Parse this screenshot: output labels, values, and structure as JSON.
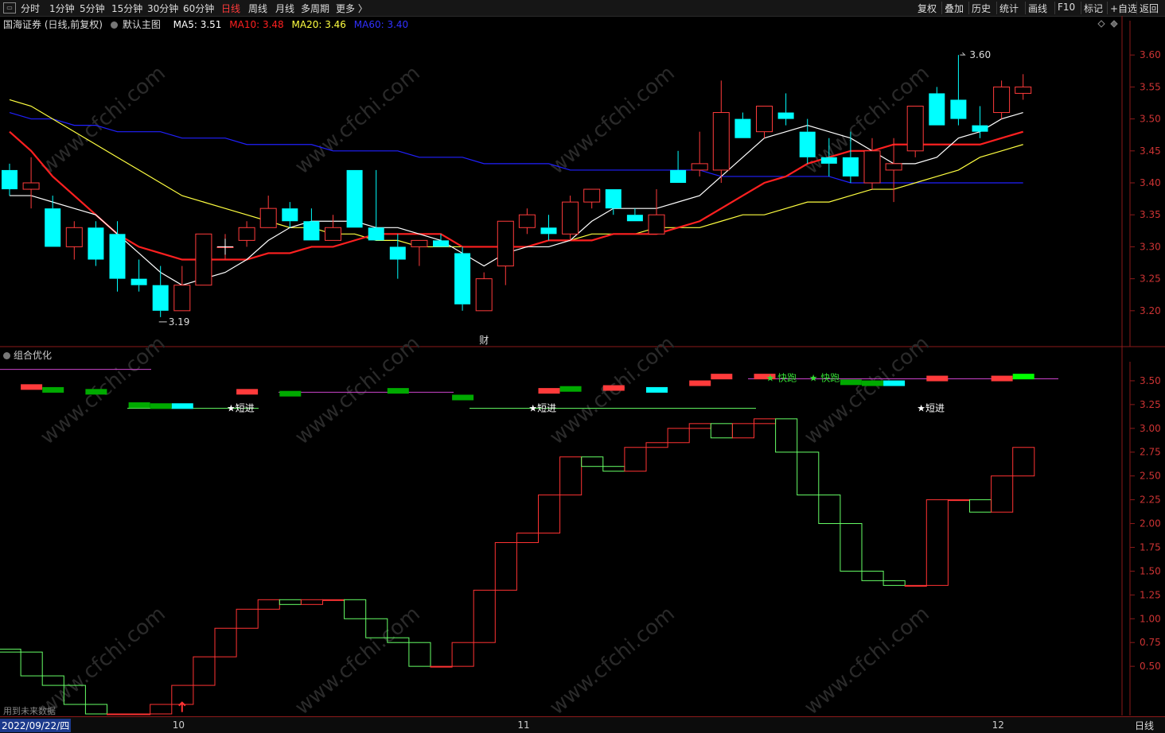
{
  "toolbar": {
    "left": [
      "分时",
      "1分钟",
      "5分钟",
      "15分钟",
      "30分钟",
      "60分钟",
      "日线",
      "周线",
      "月线",
      "多周期",
      "更多 〉"
    ],
    "active_index": 6,
    "right": [
      "复权",
      "叠加",
      "历史",
      "统计",
      "画线",
      "F10",
      "标记",
      "+自选",
      "返回"
    ]
  },
  "main": {
    "stock": "国海证券 (日线,前复权)",
    "template": "默认主图",
    "ma5": "MA5: 3.51",
    "ma10": "MA10: 3.48",
    "ma20": "MA20: 3.46",
    "ma60": "MA60: 3.40",
    "high_label": "3.60",
    "low_label": "3.19",
    "cai_label": "财"
  },
  "sub": {
    "name": "组合优化",
    "signals": [
      {
        "text": "★短进",
        "bar": 10
      },
      {
        "text": "★短进",
        "bar": 24
      },
      {
        "text": "★ 快跑",
        "bar": 35
      },
      {
        "text": "★ 快跑",
        "bar": 37
      },
      {
        "text": "★短进",
        "bar": 42
      }
    ]
  },
  "footer": "用到未来数据",
  "bottom": {
    "date": "2022/09/22/四",
    "months": [
      {
        "label": "10",
        "bar": 8
      },
      {
        "label": "11",
        "bar": 24
      },
      {
        "label": "12",
        "bar": 46
      }
    ],
    "period": "日线"
  },
  "colors": {
    "up": "#ff3b3b",
    "down": "#00ffff",
    "ma5": "#ffffff",
    "ma10": "#ff2020",
    "ma20": "#ffff40",
    "ma60": "#2020ff",
    "step_up": "#ff3333",
    "step_down": "#66ff66"
  },
  "chart_data": {
    "type": "candlestick",
    "price_axis": {
      "ylim": [
        3.16,
        3.64
      ],
      "ticks": [
        3.2,
        3.25,
        3.3,
        3.35,
        3.4,
        3.45,
        3.5,
        3.55,
        3.6
      ]
    },
    "ohlc": [
      [
        3.42,
        3.43,
        3.38,
        3.39
      ],
      [
        3.39,
        3.44,
        3.36,
        3.4
      ],
      [
        3.36,
        3.38,
        3.3,
        3.3
      ],
      [
        3.3,
        3.34,
        3.28,
        3.33
      ],
      [
        3.33,
        3.34,
        3.27,
        3.28
      ],
      [
        3.32,
        3.34,
        3.23,
        3.25
      ],
      [
        3.25,
        3.28,
        3.23,
        3.24
      ],
      [
        3.24,
        3.27,
        3.19,
        3.2
      ],
      [
        3.2,
        3.27,
        3.2,
        3.24
      ],
      [
        3.24,
        3.32,
        3.24,
        3.32
      ],
      [
        3.3,
        3.32,
        3.28,
        3.3
      ],
      [
        3.31,
        3.34,
        3.3,
        3.33
      ],
      [
        3.33,
        3.38,
        3.33,
        3.36
      ],
      [
        3.36,
        3.37,
        3.33,
        3.34
      ],
      [
        3.34,
        3.36,
        3.31,
        3.31
      ],
      [
        3.31,
        3.35,
        3.31,
        3.33
      ],
      [
        3.42,
        3.42,
        3.33,
        3.33
      ],
      [
        3.33,
        3.42,
        3.32,
        3.31
      ],
      [
        3.3,
        3.32,
        3.25,
        3.28
      ],
      [
        3.3,
        3.31,
        3.27,
        3.31
      ],
      [
        3.31,
        3.32,
        3.3,
        3.3
      ],
      [
        3.29,
        3.3,
        3.2,
        3.21
      ],
      [
        3.2,
        3.26,
        3.2,
        3.25
      ],
      [
        3.27,
        3.3,
        3.24,
        3.34
      ],
      [
        3.33,
        3.36,
        3.32,
        3.35
      ],
      [
        3.33,
        3.35,
        3.31,
        3.32
      ],
      [
        3.32,
        3.38,
        3.31,
        3.37
      ],
      [
        3.37,
        3.39,
        3.36,
        3.39
      ],
      [
        3.39,
        3.39,
        3.35,
        3.36
      ],
      [
        3.35,
        3.36,
        3.34,
        3.34
      ],
      [
        3.32,
        3.39,
        3.32,
        3.35
      ],
      [
        3.42,
        3.45,
        3.4,
        3.4
      ],
      [
        3.42,
        3.48,
        3.41,
        3.43
      ],
      [
        3.42,
        3.56,
        3.4,
        3.51
      ],
      [
        3.5,
        3.51,
        3.47,
        3.47
      ],
      [
        3.48,
        3.52,
        3.47,
        3.52
      ],
      [
        3.51,
        3.54,
        3.49,
        3.5
      ],
      [
        3.48,
        3.5,
        3.43,
        3.44
      ],
      [
        3.44,
        3.47,
        3.41,
        3.43
      ],
      [
        3.44,
        3.48,
        3.4,
        3.41
      ],
      [
        3.4,
        3.47,
        3.39,
        3.45
      ],
      [
        3.42,
        3.47,
        3.37,
        3.43
      ],
      [
        3.45,
        3.51,
        3.44,
        3.52
      ],
      [
        3.54,
        3.55,
        3.49,
        3.49
      ],
      [
        3.53,
        3.6,
        3.49,
        3.5
      ],
      [
        3.49,
        3.52,
        3.47,
        3.48
      ],
      [
        3.51,
        3.56,
        3.5,
        3.55
      ],
      [
        3.54,
        3.57,
        3.53,
        3.55
      ]
    ],
    "ma5": [
      3.38,
      3.38,
      3.37,
      3.36,
      3.35,
      3.32,
      3.29,
      3.26,
      3.24,
      3.25,
      3.26,
      3.28,
      3.31,
      3.33,
      3.34,
      3.34,
      3.34,
      3.33,
      3.33,
      3.32,
      3.31,
      3.29,
      3.27,
      3.29,
      3.3,
      3.3,
      3.31,
      3.34,
      3.36,
      3.36,
      3.36,
      3.37,
      3.38,
      3.41,
      3.44,
      3.47,
      3.48,
      3.49,
      3.48,
      3.47,
      3.45,
      3.43,
      3.43,
      3.44,
      3.47,
      3.48,
      3.5,
      3.51
    ],
    "ma10": [
      3.48,
      3.45,
      3.41,
      3.38,
      3.35,
      3.32,
      3.3,
      3.29,
      3.28,
      3.28,
      3.28,
      3.28,
      3.29,
      3.29,
      3.3,
      3.3,
      3.31,
      3.32,
      3.32,
      3.32,
      3.32,
      3.3,
      3.3,
      3.3,
      3.3,
      3.31,
      3.31,
      3.31,
      3.32,
      3.32,
      3.32,
      3.33,
      3.34,
      3.36,
      3.38,
      3.4,
      3.41,
      3.43,
      3.44,
      3.45,
      3.45,
      3.46,
      3.46,
      3.46,
      3.46,
      3.46,
      3.47,
      3.48
    ],
    "ma20": [
      3.53,
      3.52,
      3.5,
      3.48,
      3.46,
      3.44,
      3.42,
      3.4,
      3.38,
      3.37,
      3.36,
      3.35,
      3.34,
      3.33,
      3.33,
      3.32,
      3.32,
      3.31,
      3.31,
      3.3,
      3.3,
      3.3,
      3.3,
      3.3,
      3.3,
      3.31,
      3.31,
      3.32,
      3.32,
      3.32,
      3.33,
      3.33,
      3.33,
      3.34,
      3.35,
      3.35,
      3.36,
      3.37,
      3.37,
      3.38,
      3.39,
      3.39,
      3.4,
      3.41,
      3.42,
      3.44,
      3.45,
      3.46
    ],
    "ma60": [
      3.51,
      3.5,
      3.5,
      3.49,
      3.49,
      3.48,
      3.48,
      3.48,
      3.47,
      3.47,
      3.47,
      3.46,
      3.46,
      3.46,
      3.46,
      3.45,
      3.45,
      3.45,
      3.45,
      3.44,
      3.44,
      3.44,
      3.43,
      3.43,
      3.43,
      3.43,
      3.42,
      3.42,
      3.42,
      3.42,
      3.42,
      3.42,
      3.42,
      3.41,
      3.41,
      3.41,
      3.41,
      3.41,
      3.41,
      3.4,
      3.4,
      3.4,
      3.4,
      3.4,
      3.4,
      3.4,
      3.4,
      3.4
    ],
    "indicator_axis": {
      "ylim": [
        0.0,
        3.7
      ],
      "ticks": [
        0.5,
        0.75,
        1.0,
        1.25,
        1.5,
        1.75,
        2.0,
        2.25,
        2.5,
        2.75,
        3.0,
        3.25,
        3.5
      ]
    },
    "step_values": [
      0.68,
      0.65,
      0.4,
      0.3,
      0.1,
      0.0,
      0.0,
      0.0,
      0.1,
      0.3,
      0.6,
      0.9,
      1.1,
      1.2,
      1.15,
      1.2,
      1.2,
      1.0,
      0.8,
      0.75,
      0.5,
      0.5,
      0.75,
      1.3,
      1.8,
      1.9,
      2.3,
      2.7,
      2.6,
      2.55,
      2.8,
      2.85,
      3.0,
      3.05,
      2.9,
      3.05,
      3.1,
      2.75,
      2.3,
      2.0,
      1.5,
      1.4,
      1.35,
      1.35,
      2.25,
      2.25,
      2.12,
      2.5,
      2.8
    ],
    "signal_bars": [
      {
        "bar": 1,
        "v": 3.43,
        "c": "#ff3b3b"
      },
      {
        "bar": 2,
        "v": 3.4,
        "c": "#00aa00"
      },
      {
        "bar": 4,
        "v": 3.38,
        "c": "#00aa00"
      },
      {
        "bar": 6,
        "v": 3.24,
        "c": "#00aa00"
      },
      {
        "bar": 7,
        "v": 3.23,
        "c": "#00aa00"
      },
      {
        "bar": 8,
        "v": 3.23,
        "c": "#00ffff"
      },
      {
        "bar": 11,
        "v": 3.38,
        "c": "#ff3b3b"
      },
      {
        "bar": 13,
        "v": 3.36,
        "c": "#00aa00"
      },
      {
        "bar": 18,
        "v": 3.39,
        "c": "#00aa00"
      },
      {
        "bar": 21,
        "v": 3.32,
        "c": "#00aa00"
      },
      {
        "bar": 25,
        "v": 3.39,
        "c": "#ff3b3b"
      },
      {
        "bar": 26,
        "v": 3.41,
        "c": "#00aa00"
      },
      {
        "bar": 28,
        "v": 3.42,
        "c": "#ff3b3b"
      },
      {
        "bar": 30,
        "v": 3.4,
        "c": "#00ffff"
      },
      {
        "bar": 32,
        "v": 3.47,
        "c": "#ff3b3b"
      },
      {
        "bar": 33,
        "v": 3.54,
        "c": "#ff3b3b"
      },
      {
        "bar": 35,
        "v": 3.54,
        "c": "#ff3b3b"
      },
      {
        "bar": 39,
        "v": 3.48,
        "c": "#00aa00"
      },
      {
        "bar": 40,
        "v": 3.47,
        "c": "#00aa00"
      },
      {
        "bar": 41,
        "v": 3.47,
        "c": "#00ffff"
      },
      {
        "bar": 43,
        "v": 3.52,
        "c": "#ff3b3b"
      },
      {
        "bar": 46,
        "v": 3.52,
        "c": "#ff3b3b"
      },
      {
        "bar": 47,
        "v": 3.54,
        "c": "#00ff00"
      }
    ]
  }
}
